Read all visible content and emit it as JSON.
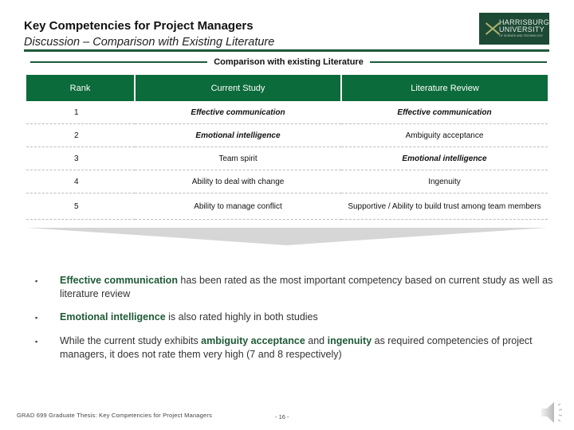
{
  "header": {
    "title": "Key Competencies for Project Managers",
    "subtitle": "Discussion – Comparison with Existing Literature",
    "logo": {
      "line1": "HARRISBURG",
      "line2": "UNIVERSITY",
      "line3": "OF SCIENCE AND TECHNOLOGY",
      "icon": "harrisburg-logo-mark"
    },
    "accent_color": "#0b6b3a"
  },
  "section": {
    "label": "Comparison with existing Literature"
  },
  "table": {
    "columns": [
      "Rank",
      "Current Study",
      "Literature Review"
    ],
    "rows": [
      {
        "rank": "1",
        "current": "Effective communication",
        "current_emphasis": true,
        "literature": "Effective communication",
        "literature_emphasis": true
      },
      {
        "rank": "2",
        "current": "Emotional intelligence",
        "current_emphasis": true,
        "literature": "Ambiguity acceptance",
        "literature_emphasis": false
      },
      {
        "rank": "3",
        "current": "Team spirit",
        "current_emphasis": false,
        "literature": "Emotional intelligence",
        "literature_emphasis": true
      },
      {
        "rank": "4",
        "current": "Ability to deal with change",
        "current_emphasis": false,
        "literature": "Ingenuity",
        "literature_emphasis": false
      },
      {
        "rank": "5",
        "current": "Ability to manage conflict",
        "current_emphasis": false,
        "literature": "Supportive / Ability to build trust among team members",
        "literature_emphasis": false
      }
    ]
  },
  "bullets": [
    {
      "parts": [
        {
          "text": "Effective communication",
          "hl": true
        },
        {
          "text": " has been rated as the most important competency based on current study as well as literature review",
          "hl": false
        }
      ]
    },
    {
      "parts": [
        {
          "text": "Emotional intelligence",
          "hl": true
        },
        {
          "text": " is also rated highly in both studies",
          "hl": false
        }
      ]
    },
    {
      "parts": [
        {
          "text": "While the current study exhibits ",
          "hl": false
        },
        {
          "text": "ambiguity acceptance",
          "hl": true
        },
        {
          "text": " and ",
          "hl": false
        },
        {
          "text": "ingenuity",
          "hl": true
        },
        {
          "text": " as required competencies of project managers, it does not rate them very high (7 and 8 respectively)",
          "hl": false
        }
      ]
    }
  ],
  "bullet_marker": "▪",
  "footer": {
    "course": "GRAD 699 Graduate Thesis: Key Competencies for Project Managers",
    "page": "- 16 -",
    "audio_icon": "speaker-icon"
  }
}
